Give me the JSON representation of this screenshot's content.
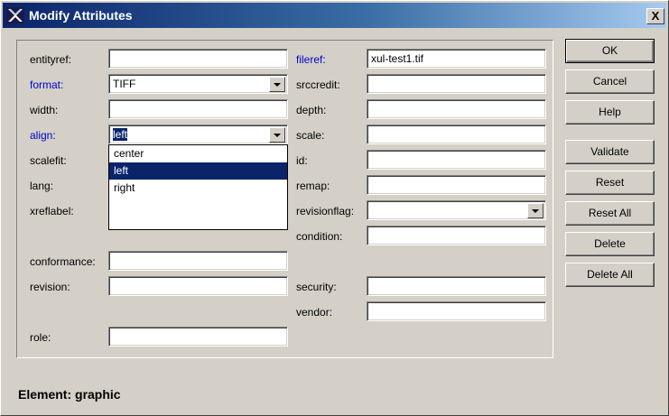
{
  "window": {
    "title": "Modify Attributes",
    "close_label": "X"
  },
  "fields_left": [
    {
      "label": "entityref:",
      "value": "",
      "required": false
    },
    {
      "label": "format:",
      "value": "TIFF",
      "required": true,
      "dropdown": true
    },
    {
      "label": "width:",
      "value": "",
      "required": false
    },
    {
      "label": "align:",
      "value": "left",
      "required": true,
      "dropdown": true
    },
    {
      "label": "scalefit:",
      "value": "",
      "required": false
    },
    {
      "label": "lang:",
      "value": "",
      "required": false
    },
    {
      "label": "xreflabel:",
      "value": "",
      "required": false
    },
    {
      "label": "conformance:",
      "value": "",
      "required": false
    },
    {
      "label": "revision:",
      "value": "",
      "required": false
    },
    {
      "label": "role:",
      "value": "",
      "required": false
    }
  ],
  "fields_right": [
    {
      "label": "fileref:",
      "value": "xul-test1.tif",
      "required": true
    },
    {
      "label": "srccredit:",
      "value": ""
    },
    {
      "label": "depth:",
      "value": ""
    },
    {
      "label": "scale:",
      "value": ""
    },
    {
      "label": "id:",
      "value": ""
    },
    {
      "label": "remap:",
      "value": ""
    },
    {
      "label": "revisionflag:",
      "value": "",
      "dropdown": true
    },
    {
      "label": "condition:",
      "value": ""
    },
    {
      "label": "security:",
      "value": ""
    },
    {
      "label": "vendor:",
      "value": ""
    }
  ],
  "align_options": [
    "center",
    "left",
    "right"
  ],
  "align_selected": "left",
  "buttons": {
    "ok": "OK",
    "cancel": "Cancel",
    "help": "Help",
    "validate": "Validate",
    "reset": "Reset",
    "reset_all": "Reset All",
    "delete": "Delete",
    "delete_all": "Delete All"
  },
  "status": "Element: graphic",
  "colors": {
    "title_start": "#0a246a",
    "required_label": "#0000cc",
    "selection": "#0a246a"
  },
  "icons": {
    "app": "x-logo-icon",
    "dropdown": "chevron-down-icon"
  }
}
